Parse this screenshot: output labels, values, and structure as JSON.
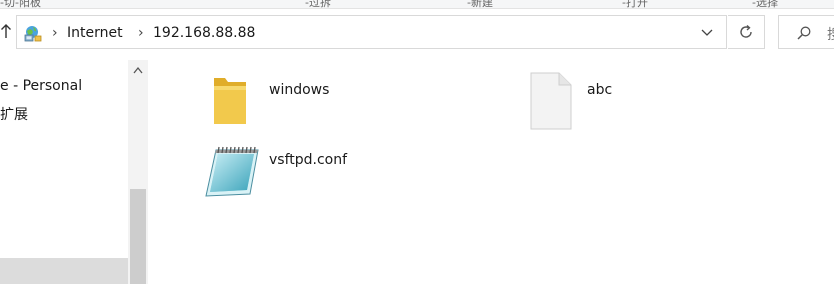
{
  "address_bar": {
    "breadcrumbs": [
      "Internet",
      "192.168.88.88"
    ]
  },
  "search": {
    "placeholder_fragment": "搜"
  },
  "ribbon": {
    "fragments": [
      "-切-阳板",
      "-过拆",
      "-新建",
      "-打开",
      "-选择"
    ]
  },
  "nav": {
    "items": [
      {
        "label": "e - Personal"
      },
      {
        "label": "扩展"
      }
    ]
  },
  "files": [
    {
      "name": "windows",
      "icon": "folder-icon"
    },
    {
      "name": "abc",
      "icon": "blank-file-icon"
    },
    {
      "name": "vsftpd.conf",
      "icon": "notepad-icon"
    }
  ],
  "colors": {
    "folder": "#f2c94c",
    "folder_dark": "#e0ad2a",
    "selection": "#dcdcdc",
    "scroll_thumb": "#cdcdcd"
  }
}
